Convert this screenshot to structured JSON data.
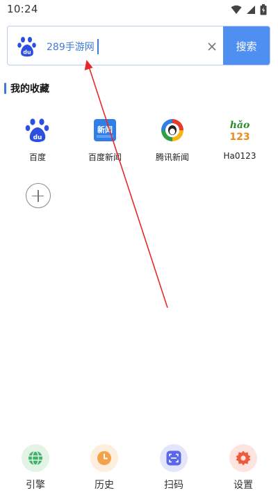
{
  "status_bar": {
    "time": "10:24"
  },
  "search": {
    "value": "289手游网",
    "button_label": "搜索",
    "accent": "#4f8ff2"
  },
  "favorites": {
    "title": "我的收藏",
    "items": [
      {
        "label": "百度",
        "icon": "baidu-paw-icon"
      },
      {
        "label": "百度新闻",
        "icon": "baidu-news-icon"
      },
      {
        "label": "腾讯新闻",
        "icon": "tencent-news-icon"
      },
      {
        "label": "Ha0123",
        "icon": "hao123-icon"
      }
    ],
    "add_icon": "plus-circle-icon"
  },
  "bottom_nav": [
    {
      "label": "引擎",
      "icon": "globe-icon",
      "color": "#3fb36a",
      "bg": "#e3f4e7"
    },
    {
      "label": "历史",
      "icon": "clock-icon",
      "color": "#f2a34a",
      "bg": "#fdeedd"
    },
    {
      "label": "扫码",
      "icon": "scan-icon",
      "color": "#5868e8",
      "bg": "#e3e6fb"
    },
    {
      "label": "设置",
      "icon": "gear-icon",
      "color": "#ef5a3c",
      "bg": "#fde4df"
    }
  ]
}
